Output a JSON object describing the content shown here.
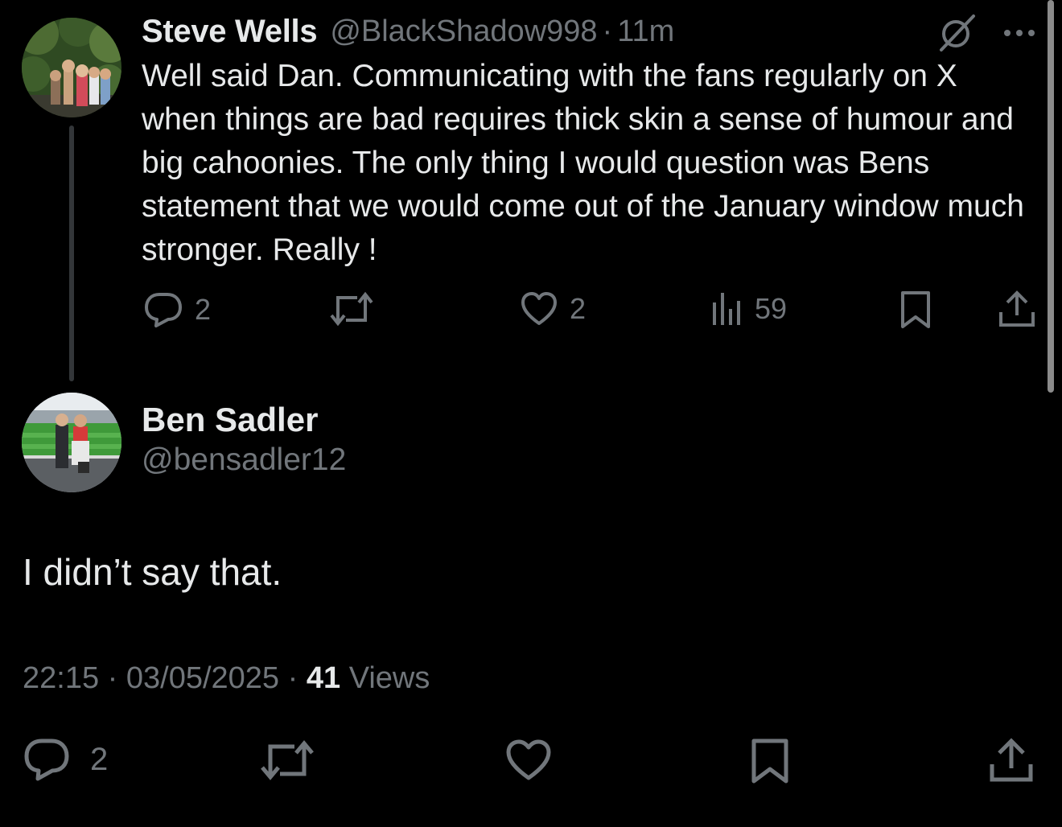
{
  "reply": {
    "author_name": "Steve Wells",
    "author_handle": "@BlackShadow998",
    "separator": "·",
    "time": "11m",
    "text": "Well said Dan. Communicating with the fans regularly on X when things are bad requires thick skin a sense of humour and big cahoonies. The only thing I would question was Bens statement that we would come out of the January window much stronger. Really !",
    "reply_count": "2",
    "like_count": "2",
    "view_count": "59"
  },
  "main_tweet": {
    "author_name": "Ben Sadler",
    "author_handle": "@bensadler12",
    "text": "I didn’t say that.",
    "time": "22:15",
    "date": "03/05/2025",
    "separator": "·",
    "views_count": "41",
    "views_label": "Views",
    "reply_count": "2"
  },
  "icons": {
    "reply": "speech-bubble-icon",
    "retweet": "retweet-icon",
    "like": "heart-icon",
    "views": "bar-chart-icon",
    "bookmark": "bookmark-icon",
    "share": "share-upload-icon",
    "grok": "grok-icon",
    "more": "more-dots-icon"
  },
  "colors": {
    "background": "#000000",
    "primary_text": "#e7e9ea",
    "secondary_text": "#71767b",
    "thread_line": "#333639"
  }
}
